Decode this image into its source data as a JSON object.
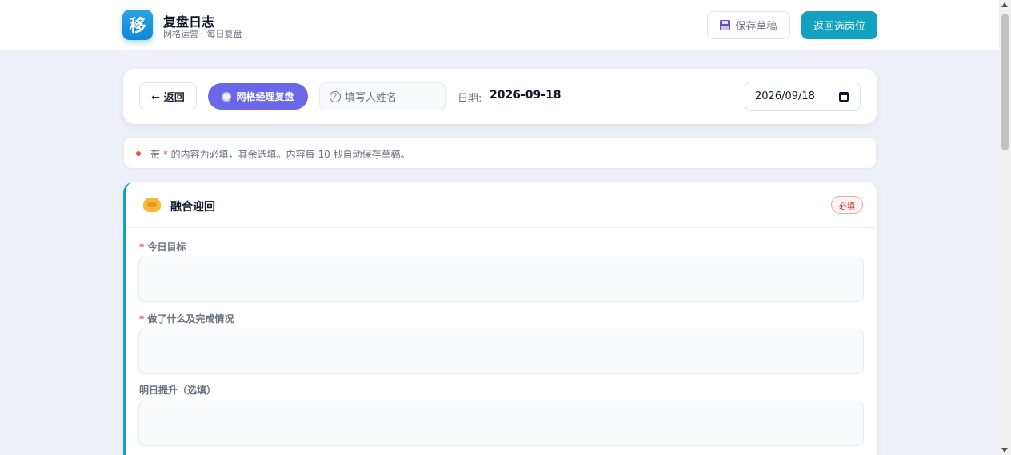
{
  "header": {
    "logo_char": "移",
    "title": "复盘日志",
    "subtitle": "网格运营 · 每日复盘",
    "save_draft_label": "保存草稿",
    "save_draft_icon": "floppy-disk-icon",
    "back_to_post_label": "返回选岗位",
    "accent_color": "#12a2bf"
  },
  "toolbar": {
    "return_label": "← 返回",
    "role_label": "网格经理复盘",
    "role_color": "#6a68e8",
    "name_placeholder": "填写人姓名",
    "date_label": "日期:",
    "date_value": "2026-09-18",
    "date_input_value": "2026/09/18"
  },
  "notice": {
    "prefix": "带 ",
    "star": "*",
    "suffix": " 的内容为必填，其余选填。内容每 10 秒自动保存草稿。"
  },
  "section": {
    "icon": "handshake-icon",
    "title": "融合迎回",
    "required_badge": "必填",
    "fields": [
      {
        "required": "*",
        "label": "今日目标"
      },
      {
        "required": "*",
        "label": "做了什么及完成情况"
      },
      {
        "required": "",
        "label": "明日提升（选填）"
      }
    ]
  }
}
